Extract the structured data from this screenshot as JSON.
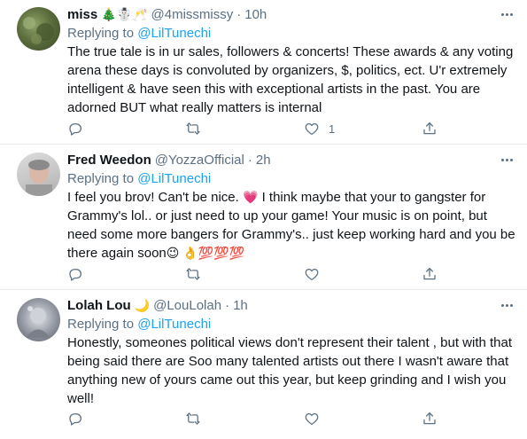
{
  "tweets": [
    {
      "name": "miss",
      "name_emoji": "🎄☃️🥂",
      "handle": "@4missmissy",
      "sep": "·",
      "time": "10h",
      "replying_label": "Replying to ",
      "replying_to": "@LilTunechi",
      "text": "The true tale is in ur sales, followers & concerts! These awards & any voting arena these days is convoluted by organizers, $, politics, ect. U'r extremely intelligent & have seen this with exceptional artists in the past. You are adorned BUT what really matters is internal",
      "like_count": "1"
    },
    {
      "name": "Fred Weedon",
      "name_emoji": "",
      "handle": "@YozzaOfficial",
      "sep": "·",
      "time": "2h",
      "replying_label": "Replying to ",
      "replying_to": "@LilTunechi",
      "text_part1": "I feel you brov! Can't be nice. ",
      "emoji1": "💗",
      "text_part2": " I think maybe that your to gangster for Grammy's lol.. or just need to up your game! Your music is on point, but need some more bangers for Grammy's.. just keep working hard and you be there again soon",
      "emoji2": "😉 👌💯💯💯",
      "like_count": ""
    },
    {
      "name": "Lolah Lou",
      "name_emoji": "🌙",
      "handle": "@LouLolah",
      "sep": "·",
      "time": "1h",
      "replying_label": "Replying to ",
      "replying_to": "@LilTunechi",
      "text": "Honestly, someones political views don't represent their talent , but with that being said there are Soo many talented artists out there I wasn't aware that anything new of yours came out this year, but keep grinding and I wish you well!",
      "like_count": ""
    }
  ],
  "icons": {
    "reply": "reply-icon",
    "retweet": "retweet-icon",
    "like": "like-icon",
    "share": "share-icon",
    "more": "more-icon"
  },
  "colors": {
    "accent": "#1da1f2",
    "secondary_text": "#5b7083",
    "divider": "#e6ecf0"
  }
}
